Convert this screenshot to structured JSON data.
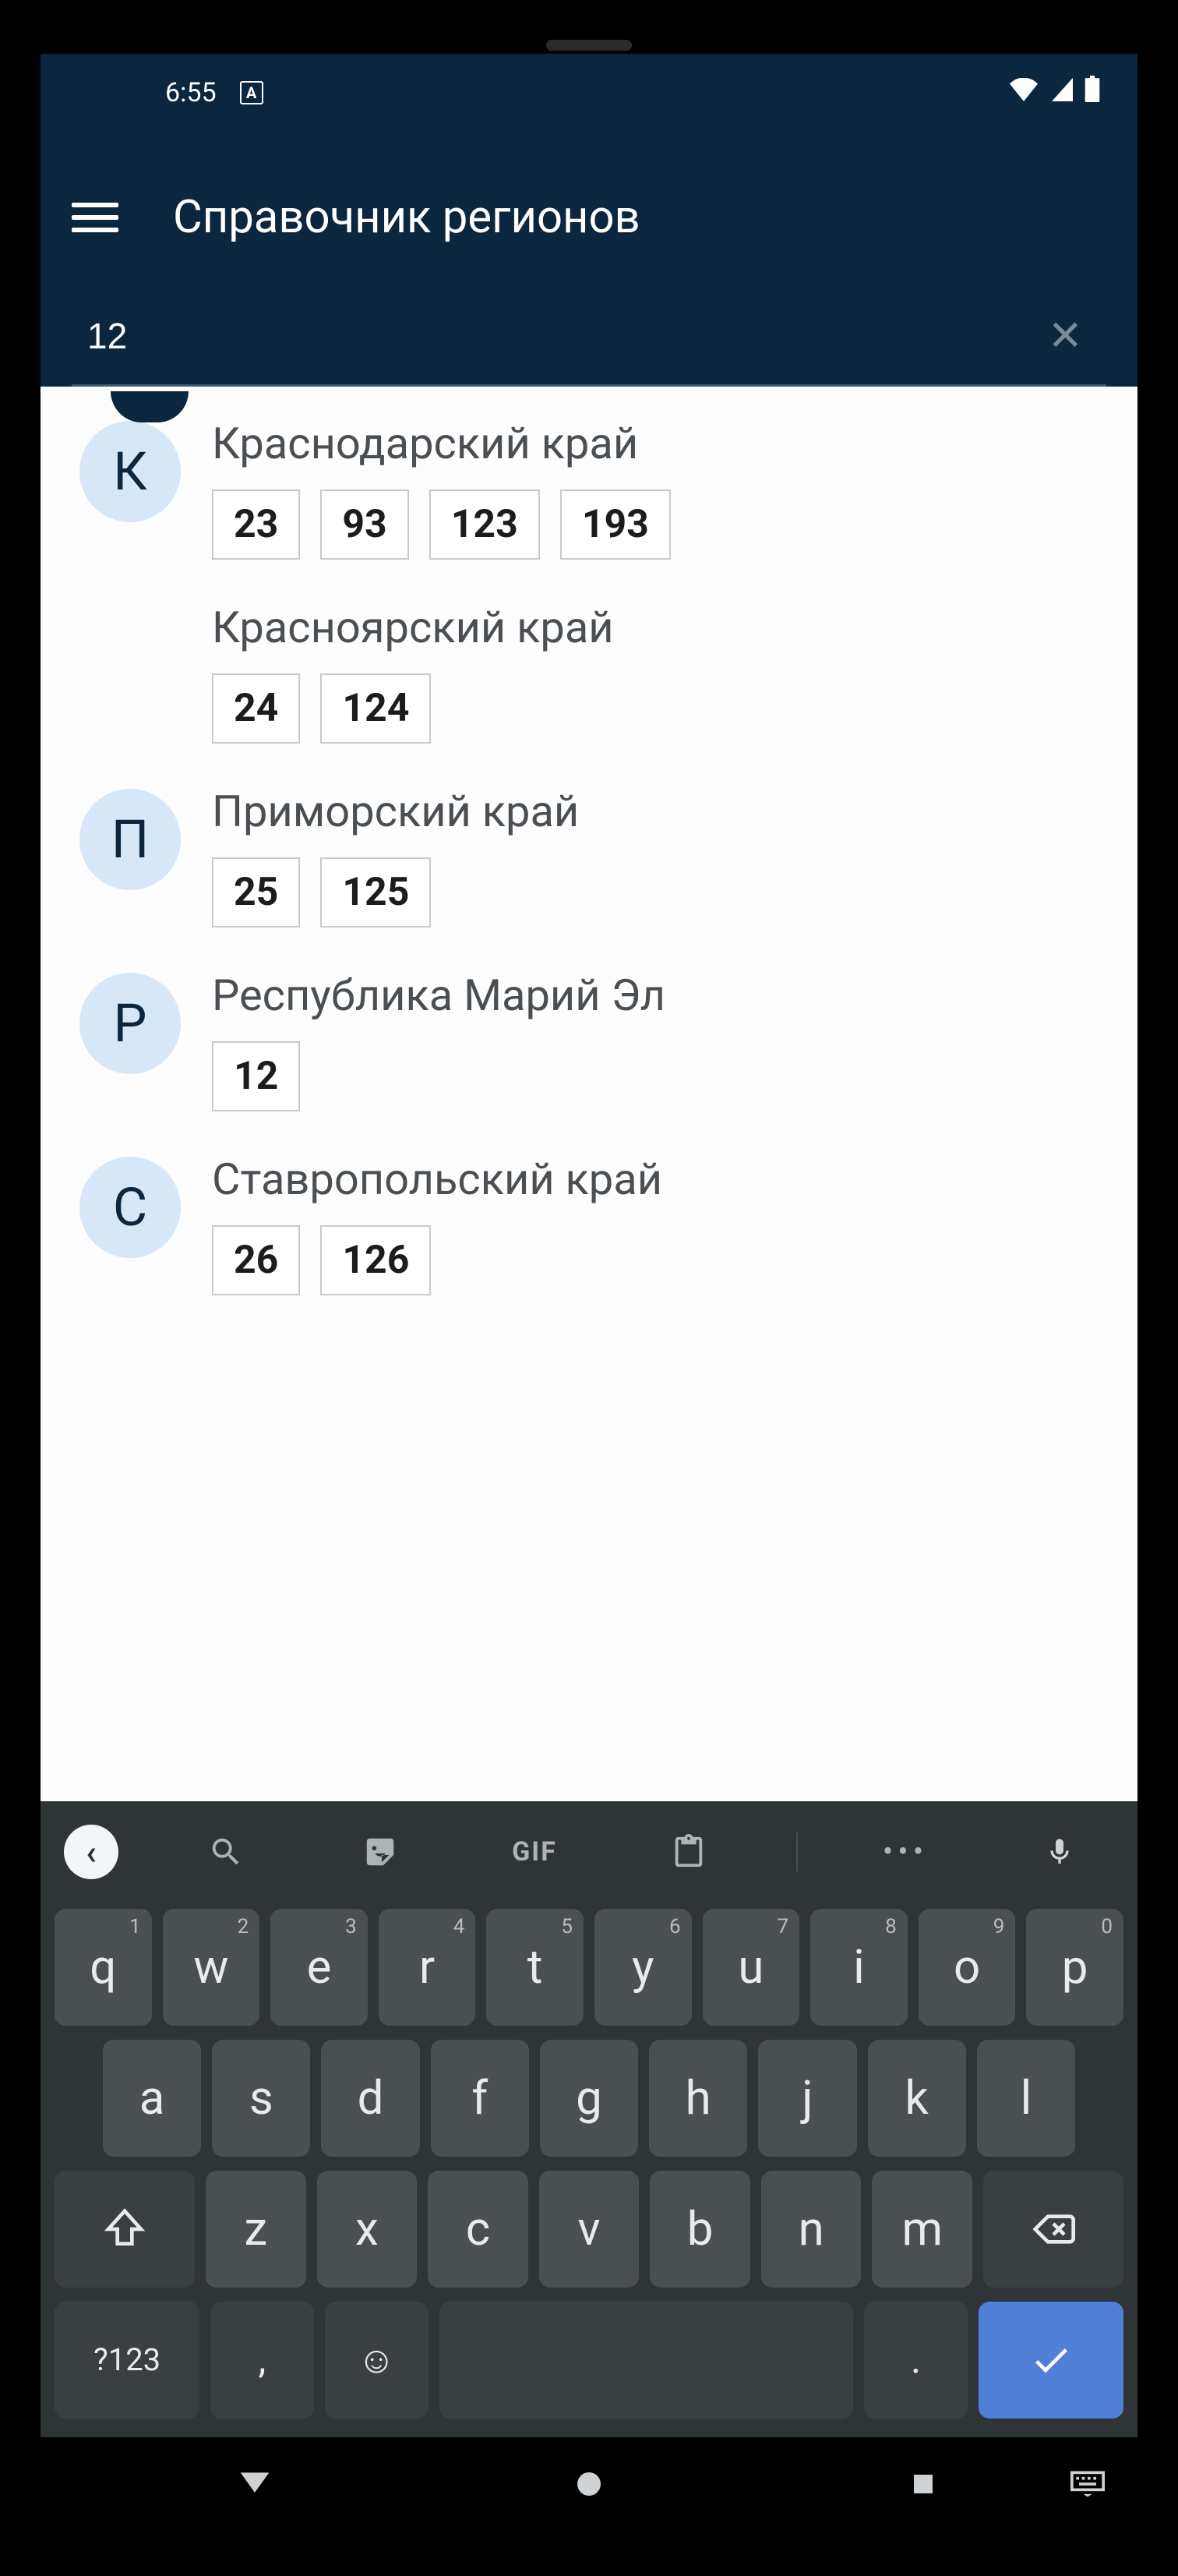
{
  "status": {
    "time": "6:55"
  },
  "appbar": {
    "title": "Справочник регионов"
  },
  "search": {
    "value": "12"
  },
  "letters": {
    "k": "К",
    "p": "П",
    "r": "Р",
    "s": "С"
  },
  "regions": [
    {
      "name": "Краснодарский край",
      "codes": [
        "23",
        "93",
        "123",
        "193"
      ]
    },
    {
      "name": "Красноярский край",
      "codes": [
        "24",
        "124"
      ]
    },
    {
      "name": "Приморский край",
      "codes": [
        "25",
        "125"
      ]
    },
    {
      "name": "Республика Марий Эл",
      "codes": [
        "12"
      ]
    },
    {
      "name": "Ставропольский край",
      "codes": [
        "26",
        "126"
      ]
    }
  ],
  "kbd": {
    "gif": "GIF",
    "row1": [
      "q",
      "w",
      "e",
      "r",
      "t",
      "y",
      "u",
      "i",
      "o",
      "p"
    ],
    "sup1": [
      "1",
      "2",
      "3",
      "4",
      "5",
      "6",
      "7",
      "8",
      "9",
      "0"
    ],
    "row2": [
      "a",
      "s",
      "d",
      "f",
      "g",
      "h",
      "j",
      "k",
      "l"
    ],
    "row3": [
      "z",
      "x",
      "c",
      "v",
      "b",
      "n",
      "m"
    ],
    "sym": "?123",
    "comma": ",",
    "dot": "."
  }
}
